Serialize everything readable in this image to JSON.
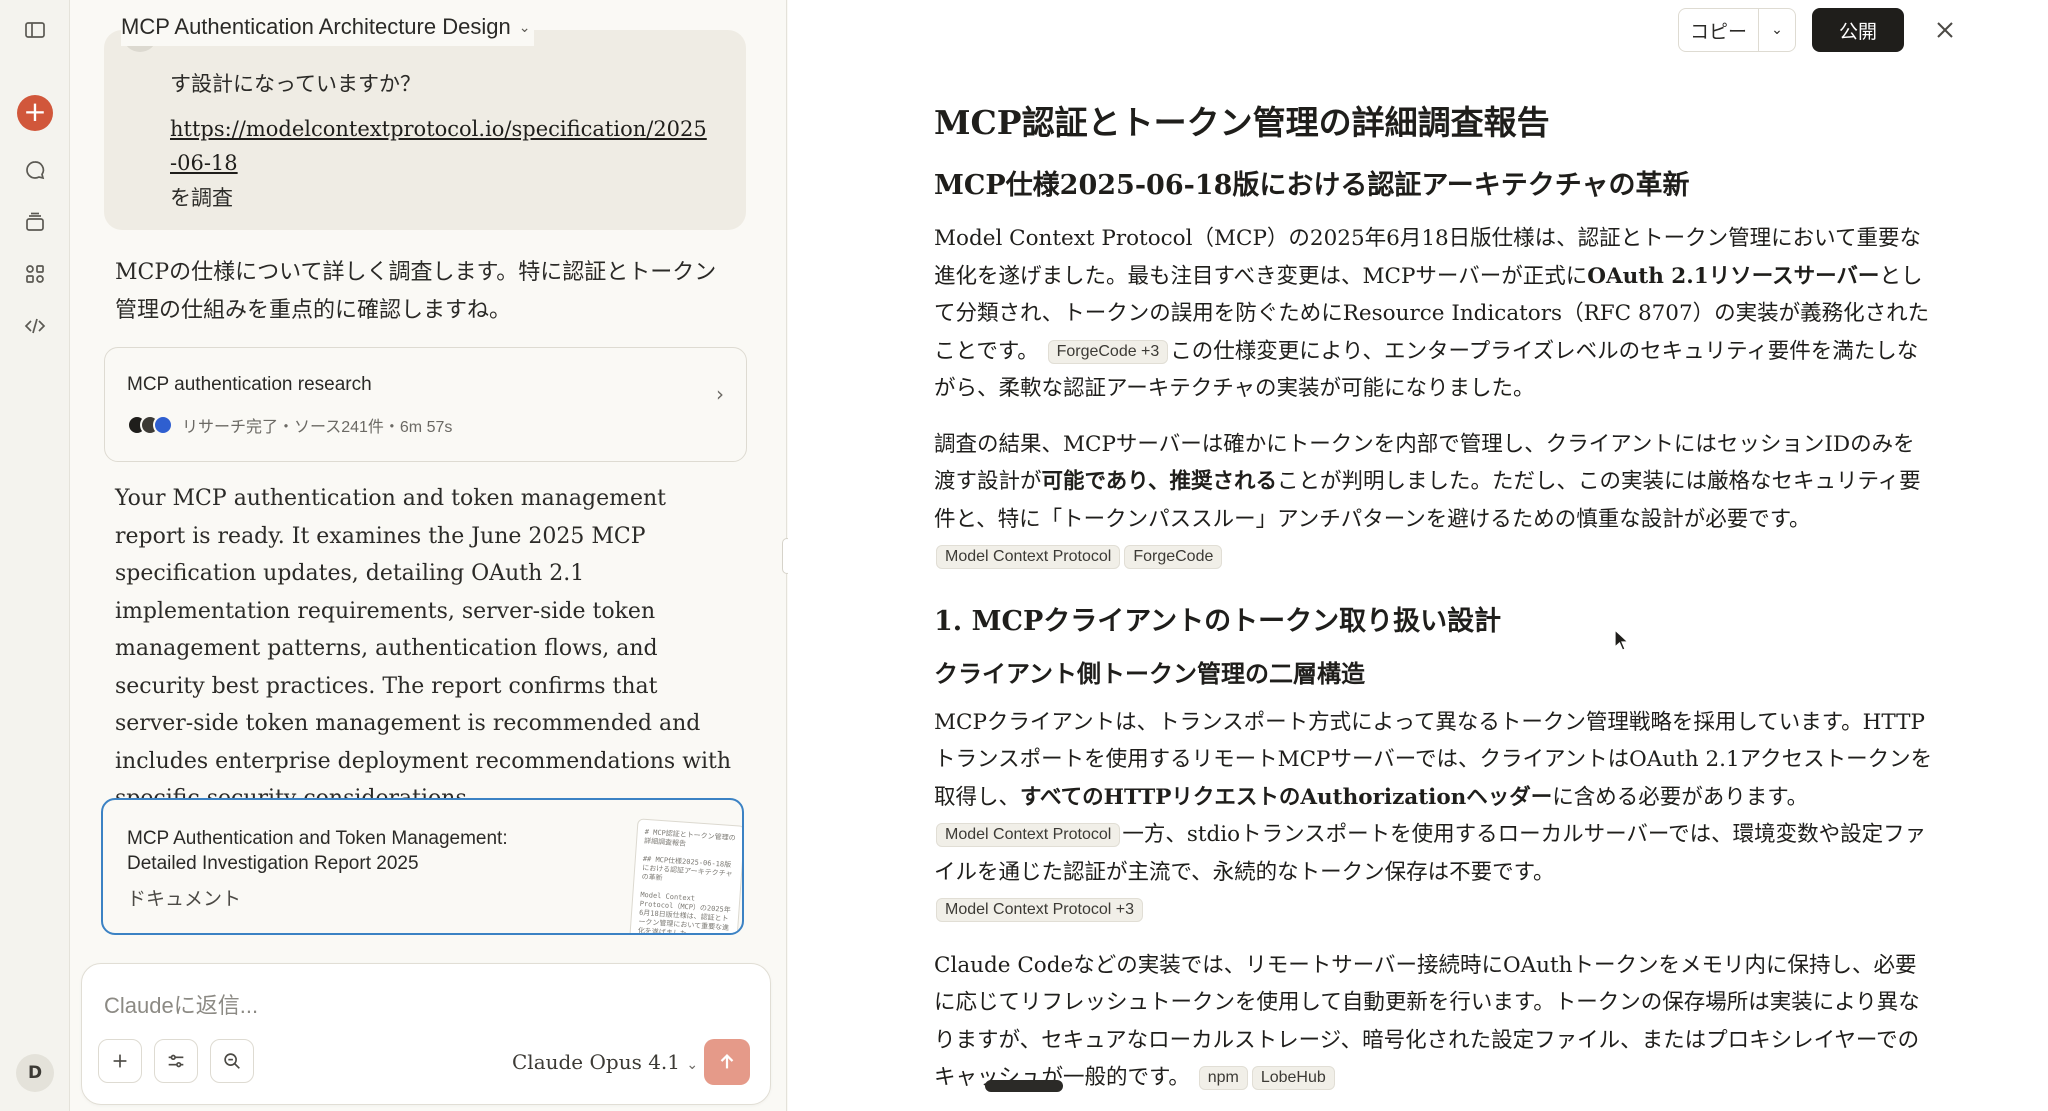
{
  "window": {
    "title": "MCP Authentication Architecture Design"
  },
  "user_message": {
    "line1": "す設計になっていますか？",
    "link": "https://modelcontextprotocol.io/specification/2025-06-18",
    "line3": "を調査"
  },
  "assistant": {
    "intro": "MCPの仕様について詳しく調査します。特に認証とトークン管理の仕組みを重点的に確認しますね。",
    "summary": "Your MCP authentication and token management report is ready. It examines the June 2025 MCP specification updates, detailing OAuth 2.1 implementation requirements, server-side token management patterns, authentication flows, and security best practices. The report confirms that server-side token management is recommended and includes enterprise deployment recommendations with specific security considerations."
  },
  "research_card": {
    "title": "MCP authentication research",
    "meta": "リサーチ完了・ソース241件・6m 57s",
    "favicon_colors": [
      "#1f1e1b",
      "#3c3a35",
      "#2f5fd0"
    ]
  },
  "doc_card": {
    "title": "MCP Authentication and Token Management: Detailed Investigation Report 2025",
    "type": "ドキュメント",
    "thumb_text": "# MCP認証とトークン管理の詳細調査報告\n\n## MCP仕様2025-06-18版における認証アーキテクチャの革新\n\nModel Context Protocol（MCP）の2025年6月18日版仕様は、認証とトークン管理において重要な進化を遂げました。"
  },
  "composer": {
    "placeholder": "Claudeに返信...",
    "model": "Claude Opus 4.1"
  },
  "user": {
    "initial": "D"
  },
  "toolbar": {
    "copy": "コピー",
    "publish": "公開"
  },
  "colors": {
    "accent": "#d1573b",
    "selected_border": "#3b82c4",
    "send": "#e59a89"
  },
  "document": {
    "h1": "MCP認証とトークン管理の詳細調査報告",
    "h2_1": "MCP仕様2025-06-18版における認証アーキテクチャの革新",
    "p1": {
      "a": "Model Context Protocol（MCP）の2025年6月18日版仕様は、認証とトークン管理において重要な進化を遂げました。最も注目すべき変更は、MCPサーバーが正式に",
      "b": "OAuth 2.1リソースサーバー",
      "c": "として分類され、トークンの誤用を防ぐためにResource Indicators（RFC 8707）の実装が義務化されたことです。",
      "cite": "ForgeCode +3",
      "d": "この仕様変更により、エンタープライズレベルのセキュリティ要件を満たしながら、柔軟な認証アーキテクチャの実装が可能になりました。"
    },
    "p2": {
      "a": "調査の結果、MCPサーバーは確かにトークンを内部で管理し、クライアントにはセッションIDのみを渡す設計が",
      "b": "可能であり、推奨される",
      "c": "ことが判明しました。ただし、この実装には厳格なセキュリティ要件と、特に「トークンパススルー」アンチパターンを避けるための慎重な設計が必要です。",
      "cite1": "Model Context Protocol",
      "cite2": "ForgeCode"
    },
    "h2_2": "1. MCPクライアントのトークン取り扱い設計",
    "h3_1": "クライアント側トークン管理の二層構造",
    "p3": {
      "a": "MCPクライアントは、トランスポート方式によって異なるトークン管理戦略を採用しています。HTTPトランスポートを使用するリモートMCPサーバーでは、クライアントはOAuth 2.1アクセストークンを取得し、",
      "b": "すべてのHTTPリクエストのAuthorizationヘッダー",
      "c": "に含める必要があります。",
      "cite1": "Model Context Protocol",
      "d": "一方、stdioトランスポートを使用するローカルサーバーでは、環境変数や設定ファイルを通じた認証が主流で、永続的なトークン保存は不要です。",
      "cite2": "Model Context Protocol +3"
    },
    "p4": {
      "a": "Claude Codeなどの実装では、リモートサーバー接続時にOAuthトークンをメモリ内に保持し、必要に応じてリフレッシュトークンを使用して自動更新を行います。トークンの保存場所は実装により異なりますが、セキュアなローカルストレージ、暗号化された設定ファイル、またはプロキシレイヤーでのキャッシュが一般的です。",
      "cite1": "npm",
      "cite2": "LobeHub"
    }
  }
}
